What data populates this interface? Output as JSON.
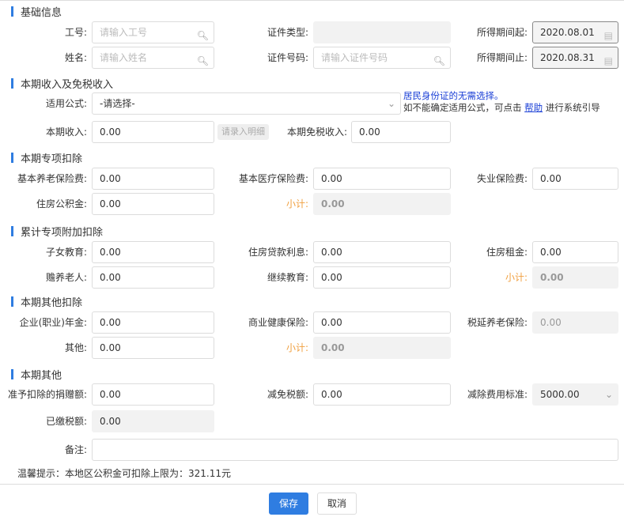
{
  "sections": {
    "basic": "基础信息",
    "income": "本期收入及免税收入",
    "special": "本期专项扣除",
    "additional": "累计专项附加扣除",
    "other_deduct": "本期其他扣除",
    "other": "本期其他"
  },
  "basic": {
    "emp_no_label": "工号:",
    "emp_no_placeholder": "请输入工号",
    "name_label": "姓名:",
    "name_placeholder": "请输入姓名",
    "id_type_label": "证件类型:",
    "id_type_value": "",
    "id_no_label": "证件号码:",
    "id_no_placeholder": "请输入证件号码",
    "period_start_label": "所得期间起:",
    "period_start": "2020.08.01",
    "period_end_label": "所得期间止:",
    "period_end": "2020.08.31"
  },
  "income": {
    "formula_label": "适用公式:",
    "formula_value": "-请选择-",
    "hint1": "居民身份证的无需选择。",
    "hint2_pre": "如不能确定适用公式，可点击",
    "hint2_link": "帮助",
    "hint2_post": "进行系统引导",
    "income_label": "本期收入:",
    "income_value": "0.00",
    "detail_button": "请录入明细",
    "exempt_label": "本期免税收入:",
    "exempt_value": "0.00"
  },
  "special": {
    "pension_label": "基本养老保险费:",
    "pension": "0.00",
    "medical_label": "基本医疗保险费:",
    "medical": "0.00",
    "unemploy_label": "失业保险费:",
    "unemploy": "0.00",
    "housing_label": "住房公积金:",
    "housing": "0.00",
    "subtotal_label": "小计:",
    "subtotal": "0.00"
  },
  "additional": {
    "child_label": "子女教育:",
    "child": "0.00",
    "loan_label": "住房贷款利息:",
    "loan": "0.00",
    "rent_label": "住房租金:",
    "rent": "0.00",
    "elder_label": "赡养老人:",
    "elder": "0.00",
    "edu_label": "继续教育:",
    "edu": "0.00",
    "subtotal_label": "小计:",
    "subtotal": "0.00"
  },
  "other_deduct": {
    "annuity_label": "企业(职业)年金:",
    "annuity": "0.00",
    "health_label": "商业健康保险:",
    "health": "0.00",
    "deferred_label": "税延养老保险:",
    "deferred": "0.00",
    "other_label": "其他:",
    "other": "0.00",
    "subtotal_label": "小计:",
    "subtotal": "0.00"
  },
  "other": {
    "donation_label": "准予扣除的捐赠额:",
    "donation": "0.00",
    "relief_label": "减免税额:",
    "relief": "0.00",
    "standard_label": "减除费用标准:",
    "standard": "5000.00",
    "paid_label": "已缴税额:",
    "paid": "0.00",
    "remark_label": "备注:",
    "remark": ""
  },
  "tip": "温馨提示：本地区公积金可扣除上限为：321.11元",
  "buttons": {
    "save": "保存",
    "cancel": "取消"
  }
}
